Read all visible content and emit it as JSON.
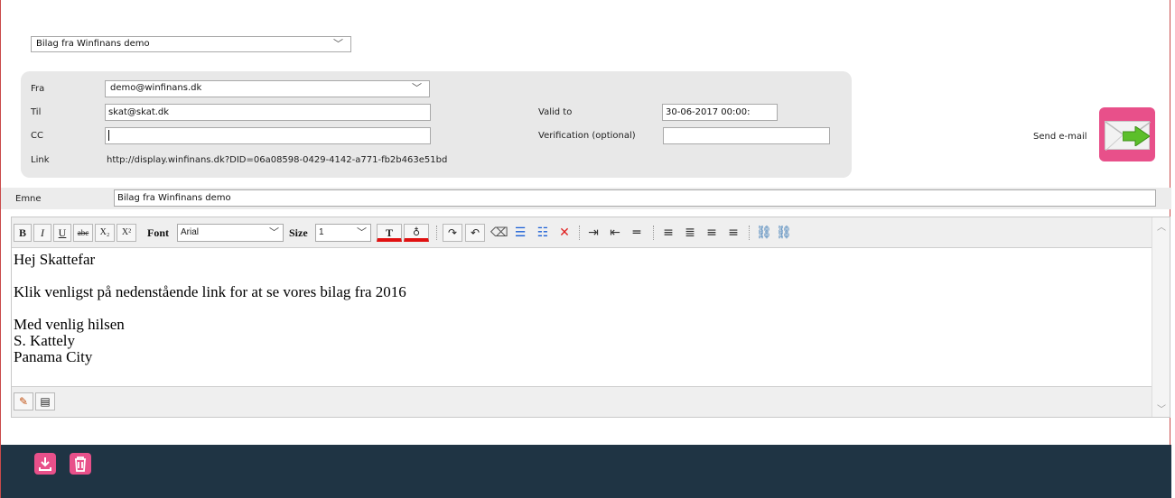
{
  "template_select": {
    "value": "Bilag fra Winfinans demo"
  },
  "form": {
    "fra_label": "Fra",
    "fra_value": "demo@winfinans.dk",
    "til_label": "Til",
    "til_value": "skat@skat.dk",
    "cc_label": "CC",
    "cc_value": "",
    "link_label": "Link",
    "link_value": "http://display.winfinans.dk?DID=06a08598-0429-4142-a771-fb2b463e51bd",
    "valid_to_label": "Valid to",
    "valid_to_value": "30-06-2017 00:00:",
    "verification_label": "Verification (optional)",
    "verification_value": ""
  },
  "send": {
    "label": "Send e-mail",
    "icon": "envelope-send-icon"
  },
  "subject": {
    "label": "Emne",
    "value": "Bilag fra Winfinans demo"
  },
  "toolbar": {
    "bold": "B",
    "italic": "I",
    "underline": "U",
    "strike": "abc",
    "subscript": "X₂",
    "superscript": "X²",
    "font_label": "Font",
    "font_value": "Arial",
    "size_label": "Size",
    "size_value": "1",
    "text_color": "T"
  },
  "body": {
    "line1": "Hej Skattefar",
    "line2": "Klik venligst på nedenstående link for at se vores bilag fra 2016",
    "line3": "Med venlig hilsen",
    "line4": "S. Kattely",
    "line5": "Panama City"
  },
  "colors": {
    "accent": "#e8508a",
    "bottom_bar": "#1f3444",
    "border_red": "#c94a4a"
  }
}
